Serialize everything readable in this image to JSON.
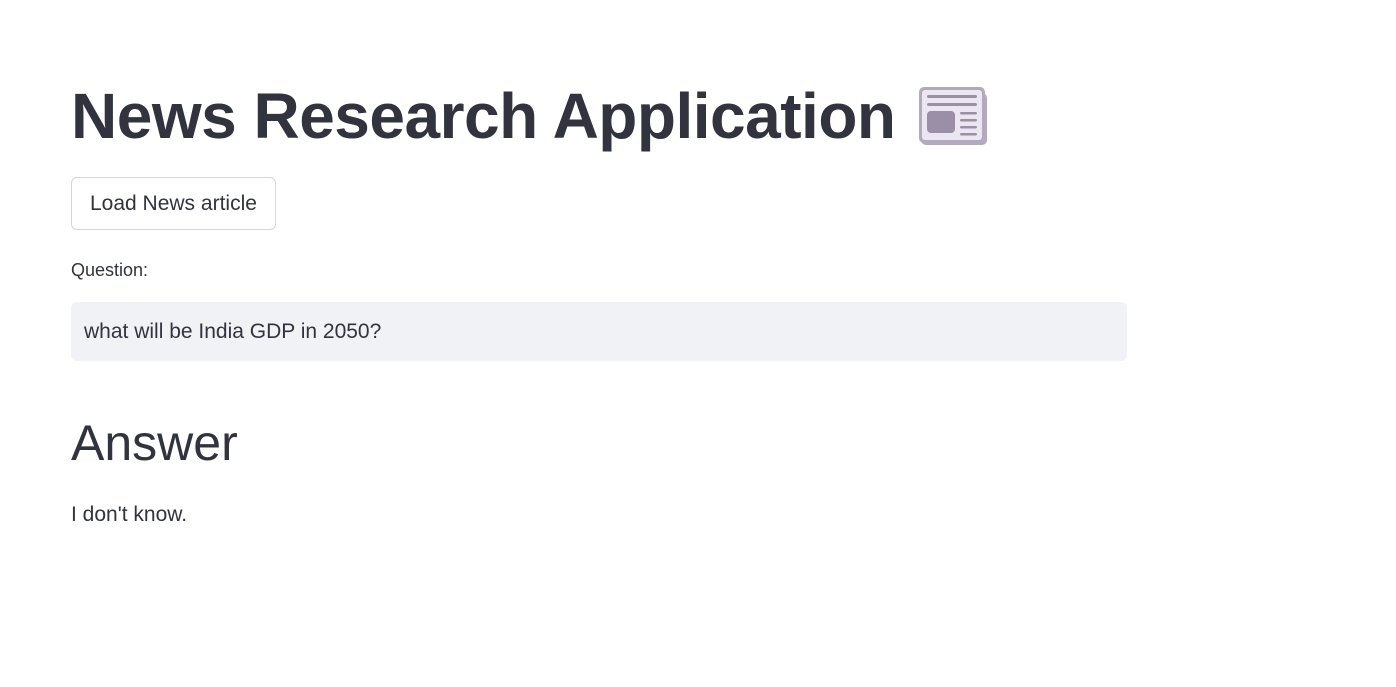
{
  "app": {
    "title": "News Research Application",
    "title_icon": "newspaper-icon"
  },
  "controls": {
    "load_button_label": "Load News article"
  },
  "question": {
    "label": "Question:",
    "value": "what will be India GDP in 2050?"
  },
  "answer": {
    "heading": "Answer",
    "text": "I don't know."
  },
  "colors": {
    "text": "#31333f",
    "input_background": "#f0f2f6",
    "button_border": "#d6d6d9",
    "icon_paper": "#ece6f0",
    "icon_accent": "#9b8fa8"
  }
}
